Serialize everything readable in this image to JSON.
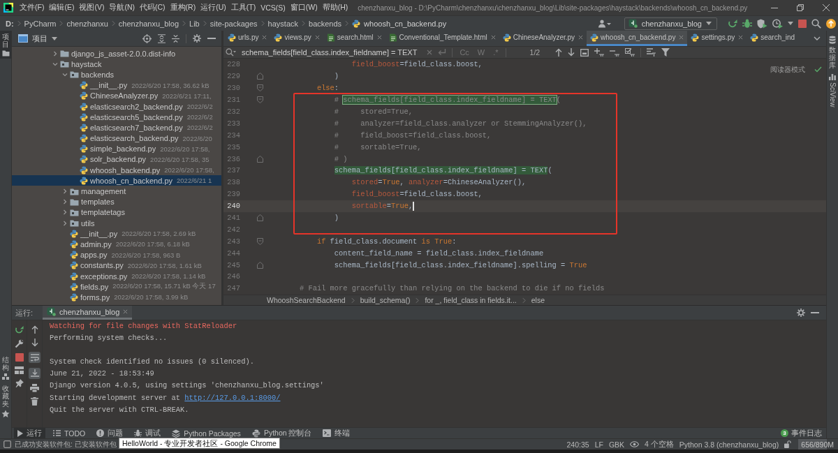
{
  "menu_bar": {
    "items": [
      "文件(F)",
      "编辑(E)",
      "视图(V)",
      "导航(N)",
      "代码(C)",
      "重构(R)",
      "运行(U)",
      "工具(T)",
      "VCS(S)",
      "窗口(W)",
      "帮助(H)"
    ],
    "window_title": "chenzhanxu_blog - D:\\PyCharm\\chenzhanxu\\chenzhanxu_blog\\Lib\\site-packages\\haystack\\backends\\whoosh_cn_backend.py"
  },
  "navigation_bar": {
    "path": [
      {
        "label": "D:",
        "kind": "drive"
      },
      {
        "label": "PyCharm",
        "kind": "folder"
      },
      {
        "label": "chenzhanxu",
        "kind": "folder"
      },
      {
        "label": "chenzhanxu_blog",
        "kind": "folder"
      },
      {
        "label": "Lib",
        "kind": "folder"
      },
      {
        "label": "site-packages",
        "kind": "folder"
      },
      {
        "label": "haystack",
        "kind": "folder"
      },
      {
        "label": "backends",
        "kind": "folder"
      },
      {
        "label": "whoosh_cn_backend.py",
        "kind": "python"
      }
    ],
    "run_configuration": "chenzhanxu_blog"
  },
  "side_tools": {
    "left_top": [
      {
        "label": "项目",
        "kind": "project",
        "selected": true
      }
    ],
    "left_bottom": [
      {
        "label": "结构",
        "kind": "structure",
        "selected": false
      },
      {
        "label": "收藏夹",
        "kind": "favorites",
        "selected": false
      }
    ],
    "right": [
      {
        "label": "数据库",
        "kind": "database",
        "selected": false
      },
      {
        "label": "SciView",
        "kind": "sciview",
        "selected": false
      }
    ]
  },
  "project_panel": {
    "title": "项目",
    "tree": [
      {
        "name": "django_js_asset-2.0.0.dist-info",
        "kind": "folder",
        "expanded": false,
        "selected": false
      },
      {
        "name": "haystack",
        "kind": "package",
        "expanded": true,
        "selected": false,
        "children": [
          {
            "name": "backends",
            "kind": "package",
            "expanded": true,
            "selected": false,
            "children": [
              {
                "name": "__init__.py",
                "kind": "file",
                "info": "2022/6/20 17:58, 36.62 kB",
                "selected": false
              },
              {
                "name": "ChineseAnalyzer.py",
                "kind": "file",
                "info": "2022/6/21 17:11,",
                "selected": false
              },
              {
                "name": "elasticsearch2_backend.py",
                "kind": "file",
                "info": "2022/6/2",
                "selected": false
              },
              {
                "name": "elasticsearch5_backend.py",
                "kind": "file",
                "info": "2022/6/2",
                "selected": false
              },
              {
                "name": "elasticsearch7_backend.py",
                "kind": "file",
                "info": "2022/6/2",
                "selected": false
              },
              {
                "name": "elasticsearch_backend.py",
                "kind": "file",
                "info": "2022/6/20",
                "selected": false
              },
              {
                "name": "simple_backend.py",
                "kind": "file",
                "info": "2022/6/20 17:58,",
                "selected": false
              },
              {
                "name": "solr_backend.py",
                "kind": "file",
                "info": "2022/6/20 17:58, 35",
                "selected": false
              },
              {
                "name": "whoosh_backend.py",
                "kind": "file",
                "info": "2022/6/20 17:58,",
                "selected": false
              },
              {
                "name": "whoosh_cn_backend.py",
                "kind": "file",
                "info": "2022/6/21 1",
                "selected": true
              }
            ]
          },
          {
            "name": "management",
            "kind": "package",
            "expanded": false,
            "selected": false
          },
          {
            "name": "templates",
            "kind": "folder",
            "expanded": false,
            "selected": false
          },
          {
            "name": "templatetags",
            "kind": "package",
            "expanded": false,
            "selected": false
          },
          {
            "name": "utils",
            "kind": "package",
            "expanded": false,
            "selected": false
          },
          {
            "name": "__init__.py",
            "kind": "file",
            "info": "2022/6/20 17:58, 2.69 kB",
            "selected": false
          },
          {
            "name": "admin.py",
            "kind": "file",
            "info": "2022/6/20 17:58, 6.18 kB",
            "selected": false
          },
          {
            "name": "apps.py",
            "kind": "file",
            "info": "2022/6/20 17:58, 963 B",
            "selected": false
          },
          {
            "name": "constants.py",
            "kind": "file",
            "info": "2022/6/20 17:58, 1.61 kB",
            "selected": false
          },
          {
            "name": "exceptions.py",
            "kind": "file",
            "info": "2022/6/20 17:58, 1.14 kB",
            "selected": false
          },
          {
            "name": "fields.py",
            "kind": "file",
            "info": "2022/6/20 17:58, 15.71 kB 今天 17",
            "selected": false
          },
          {
            "name": "forms.py",
            "kind": "file",
            "info": "2022/6/20 17:58, 3.99 kB",
            "selected": false
          }
        ]
      }
    ]
  },
  "editor": {
    "tabs": [
      {
        "label": "urls.py",
        "kind": "python",
        "selected": false,
        "closable": true
      },
      {
        "label": "views.py",
        "kind": "python",
        "selected": false,
        "closable": true
      },
      {
        "label": "search.html",
        "kind": "html",
        "selected": false,
        "closable": true
      },
      {
        "label": "Conventional_Template.html",
        "kind": "html",
        "selected": false,
        "closable": true
      },
      {
        "label": "ChineseAnalyzer.py",
        "kind": "python",
        "selected": false,
        "closable": true
      },
      {
        "label": "whoosh_cn_backend.py",
        "kind": "python",
        "selected": true,
        "closable": true
      },
      {
        "label": "settings.py",
        "kind": "python",
        "selected": false,
        "closable": true
      },
      {
        "label": "search_ind",
        "kind": "python",
        "selected": false,
        "closable": false
      }
    ],
    "find_bar": {
      "query": "schema_fields[field_class.index_fieldname] = TEXT",
      "options": [
        {
          "label": "Cc",
          "on": false
        },
        {
          "label": "W",
          "on": false
        },
        {
          "label": ".*",
          "on": false
        }
      ],
      "match_count": "1/2"
    },
    "reader_mode": "阅读器模式",
    "lines": [
      {
        "number": "228",
        "current": false,
        "tokens": [
          {
            "kind": "param",
            "text": "                field_boost"
          },
          {
            "kind": "plain",
            "text": "=field_class.boost,"
          }
        ]
      },
      {
        "number": "229",
        "current": false,
        "fold_end": true,
        "tokens": [
          {
            "kind": "plain",
            "text": "            )"
          }
        ]
      },
      {
        "number": "230",
        "current": false,
        "fold_start": true,
        "tokens": [
          {
            "kind": "keyword",
            "text": "        else"
          },
          {
            "kind": "plain",
            "text": ":"
          }
        ]
      },
      {
        "number": "231",
        "current": false,
        "fold_start": true,
        "tokens": [
          {
            "kind": "comment",
            "text": "            # "
          },
          {
            "kind": "comment",
            "text": "schema_fields[field_class.index_fieldname] = TEXT",
            "match": true,
            "current_match": true
          },
          {
            "kind": "comment",
            "text": "("
          }
        ]
      },
      {
        "number": "232",
        "current": false,
        "tokens": [
          {
            "kind": "comment",
            "text": "            #     stored=True,"
          }
        ]
      },
      {
        "number": "233",
        "current": false,
        "tokens": [
          {
            "kind": "comment",
            "text": "            #     analyzer=field_class.analyzer or StemmingAnalyzer(),"
          }
        ]
      },
      {
        "number": "234",
        "current": false,
        "tokens": [
          {
            "kind": "comment",
            "text": "            #     field_boost=field_class.boost,"
          }
        ]
      },
      {
        "number": "235",
        "current": false,
        "tokens": [
          {
            "kind": "comment",
            "text": "            #     sortable=True,"
          }
        ]
      },
      {
        "number": "236",
        "current": false,
        "fold_end": true,
        "tokens": [
          {
            "kind": "comment",
            "text": "            # )"
          }
        ]
      },
      {
        "number": "237",
        "current": false,
        "tokens": [
          {
            "kind": "plain",
            "text": "            schema_fields[field_class.index_fieldname] = TEXT",
            "match": true,
            "current_match": false
          },
          {
            "kind": "plain",
            "text": "("
          }
        ]
      },
      {
        "number": "238",
        "current": false,
        "tokens": [
          {
            "kind": "param",
            "text": "                stored"
          },
          {
            "kind": "plain",
            "text": "="
          },
          {
            "kind": "keyword",
            "text": "True"
          },
          {
            "kind": "plain",
            "text": ", "
          },
          {
            "kind": "param",
            "text": "analyzer"
          },
          {
            "kind": "plain",
            "text": "=ChineseAnalyzer(),"
          }
        ]
      },
      {
        "number": "239",
        "current": false,
        "tokens": [
          {
            "kind": "param",
            "text": "                field_boost"
          },
          {
            "kind": "plain",
            "text": "=field_class.boost,"
          }
        ]
      },
      {
        "number": "240",
        "current": true,
        "tokens": [
          {
            "kind": "param",
            "text": "                sortable"
          },
          {
            "kind": "plain",
            "text": "="
          },
          {
            "kind": "keyword",
            "text": "True"
          },
          {
            "kind": "plain",
            "text": ","
          }
        ]
      },
      {
        "number": "241",
        "current": false,
        "fold_end": true,
        "tokens": [
          {
            "kind": "plain",
            "text": "            )"
          }
        ]
      },
      {
        "number": "242",
        "current": false
      },
      {
        "number": "243",
        "current": false,
        "fold_start": true,
        "tokens": [
          {
            "kind": "keyword",
            "text": "        if"
          },
          {
            "kind": "plain",
            "text": " field_class.document "
          },
          {
            "kind": "keyword",
            "text": "is True"
          },
          {
            "kind": "plain",
            "text": ":"
          }
        ]
      },
      {
        "number": "244",
        "current": false,
        "tokens": [
          {
            "kind": "plain",
            "text": "            content_field_name = field_class.index_fieldname"
          }
        ]
      },
      {
        "number": "245",
        "current": false,
        "fold_end": true,
        "tokens": [
          {
            "kind": "plain",
            "text": "            schema_fields[field_class.index_fieldname].spelling = "
          },
          {
            "kind": "keyword",
            "text": "True"
          }
        ]
      },
      {
        "number": "246",
        "current": false
      },
      {
        "number": "247",
        "current": false,
        "tokens": [
          {
            "kind": "comment",
            "text": "    # Fail more gracefully than relying on the backend to die if no fields"
          }
        ]
      }
    ],
    "breadcrumbs": [
      "WhooshSearchBackend",
      "build_schema()",
      "for _, field_class in fields.it...",
      "else"
    ]
  },
  "run_panel": {
    "title": "运行:",
    "tabs": [
      {
        "label": "chenzhanxu_blog",
        "selected": true
      }
    ],
    "console_toggles": [
      {
        "kind": "soft_wrap",
        "on": true
      },
      {
        "kind": "scroll_to_end",
        "on": true
      }
    ],
    "console_blocks": [
      {
        "lines": [
          {
            "kind": "error",
            "text": "Watching for file changes with StatReloader"
          },
          {
            "kind": "info",
            "text": "Performing system checks..."
          }
        ]
      },
      {
        "lines": [
          {
            "kind": "info",
            "text": "System check identified no issues (0 silenced)."
          },
          {
            "kind": "info",
            "text": "June 21, 2022 - 18:53:49"
          },
          {
            "kind": "info",
            "text": "Django version 4.0.5, using settings 'chenzhanxu_blog.settings'"
          },
          {
            "kind": "info",
            "text": "Starting development server at ",
            "link": "http://127.0.0.1:8000/"
          },
          {
            "kind": "info",
            "text": "Quit the server with CTRL-BREAK."
          }
        ]
      }
    ]
  },
  "tool_window_bar": {
    "items": [
      {
        "label": "运行",
        "kind": "run",
        "selected": true
      },
      {
        "label": "TODO",
        "kind": "todo",
        "selected": false
      },
      {
        "label": "问题",
        "kind": "problems",
        "selected": false
      },
      {
        "label": "调试",
        "kind": "debug",
        "selected": false
      },
      {
        "label": "Python Packages",
        "kind": "packages",
        "selected": false
      },
      {
        "label": "Python 控制台",
        "kind": "console",
        "selected": false
      },
      {
        "label": "终端",
        "kind": "terminal",
        "selected": false
      }
    ],
    "event_log": {
      "label": "事件日志",
      "count": "3"
    }
  },
  "status_bar": {
    "message": "已成功安装软件包: 已安装软件包",
    "tooltip": "HelloWorld - 专业开发者社区 - Google Chrome",
    "caret_position": "240:35",
    "line_separator": "LF",
    "encoding": "GBK",
    "indent": "4 个空格",
    "interpreter": "Python 3.8 (chenzhanxu_blog)",
    "memory": {
      "reading": "656/890M",
      "level": 0.74
    }
  }
}
